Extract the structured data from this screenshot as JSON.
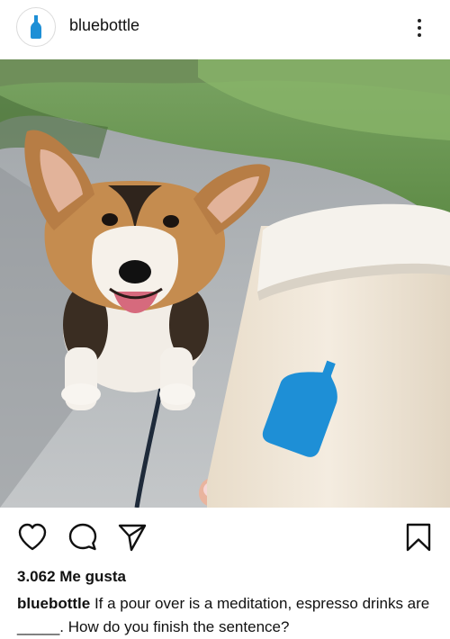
{
  "post": {
    "username": "bluebottle",
    "likes_text": "3.062 Me gusta",
    "caption_user": "bluebottle",
    "caption_text": " If a pour over is a meditation, espresso drinks are _____. How do you finish the sentence?"
  },
  "icons": {
    "avatar": "blue-bottle-logo-icon",
    "more": "more-options-icon",
    "like": "heart-icon",
    "comment": "comment-icon",
    "share": "share-icon",
    "save": "bookmark-icon"
  },
  "colors": {
    "brand_blue": "#1e8fd6",
    "text": "#111111"
  }
}
